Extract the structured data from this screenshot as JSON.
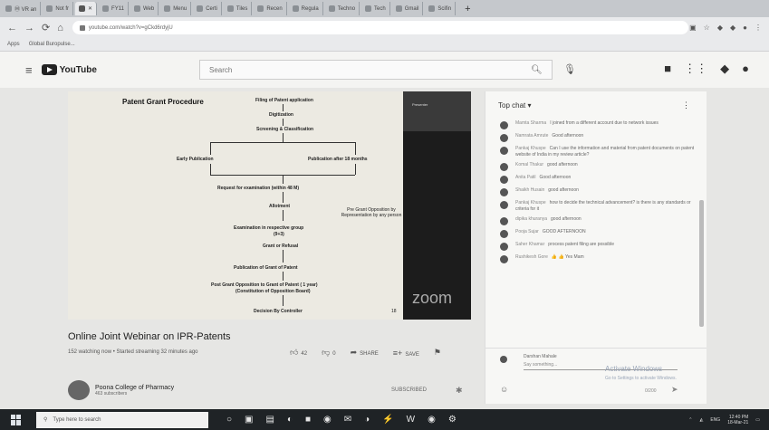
{
  "browser": {
    "tabs": [
      "Ⓜ VR an",
      "Not fr",
      "",
      "FY11",
      "Web",
      "Menu",
      "Certi",
      "Tiles",
      "Recen",
      "Regula",
      "Techno",
      "Tech",
      "Gmail",
      "Scifin"
    ],
    "new_tab": "+",
    "url": "youtube.com/watch?v=gCkd6rdyjU",
    "bookmarks": [
      "Apps",
      "Global Buropulse..."
    ]
  },
  "youtube": {
    "logo_text": "YouTube",
    "search_placeholder": "Search"
  },
  "video": {
    "slide_title": "Patent Grant Procedure",
    "steps": {
      "filing": "Filing of Patent application",
      "digitization": "Digitization",
      "screening": "Screening & Classification",
      "early": "Early Publication",
      "after18": "Publication after 18 months",
      "request": "Request for examination (within 48 M)",
      "allotment": "Allotment",
      "examination": "Examination in respective group",
      "exam_time": "(9+3)",
      "grant_refusal": "Grant or Refusal",
      "publication": "Publication of Grant of Patent",
      "post_grant": "Post Grant Opposition to Grant of Patent ( 1 year)",
      "constitution": "(Constitution of Opposition Board)",
      "decision": "Decision By Controller",
      "pre_grant": "Pre Grant Opposition by Representation by any person",
      "slide_no": "18"
    },
    "cam_label": "Presenter",
    "zoom_text": "zoom",
    "title": "Online Joint Webinar on IPR-Patents",
    "meta": "152 watching now • Started streaming 32 minutes ago",
    "likes": "42",
    "dislikes": "0",
    "share": "SHARE",
    "save": "SAVE",
    "channel_name": "Poona College of Pharmacy",
    "channel_subs": "463 subscribers",
    "subscribed": "SUBSCRIBED"
  },
  "chat": {
    "header": "Top chat",
    "messages": [
      {
        "author": "Mamta Sharma",
        "text": "I joined from a different account due to network issues"
      },
      {
        "author": "Namrata Amrute",
        "text": "Good afternoon"
      },
      {
        "author": "Pankaj Khuspe",
        "text": "Can I use the information and material from patent documents on patent website of India in my review article?"
      },
      {
        "author": "Komal Thakur",
        "text": "good afternoon"
      },
      {
        "author": "Anita Patil",
        "text": "Good afternoon"
      },
      {
        "author": "Shaikh Husain",
        "text": "good afternoon"
      },
      {
        "author": "Pankaj Khuspe",
        "text": "how to decide the technical advancement? is there is any standards or criteria for it"
      },
      {
        "author": "dipika khuranya",
        "text": "good afternoon"
      },
      {
        "author": "Pooja Sujar",
        "text": "GOOD AFTERNOON"
      },
      {
        "author": "Saher Khamar",
        "text": "process patent filing are possible"
      },
      {
        "author": "Rushikesh Gore",
        "text": "👍 👍 Yes Mam"
      }
    ],
    "input_name": "Darshan Mahale",
    "input_placeholder": "Say something...",
    "count": "0/200"
  },
  "windows": {
    "activate": "Activate Windows",
    "activate_sub": "Go to Settings to activate Windows."
  },
  "taskbar": {
    "search": "Type here to search",
    "tray_lang": "ENG",
    "time": "12:40 PM",
    "date": "18-Mar-21"
  }
}
